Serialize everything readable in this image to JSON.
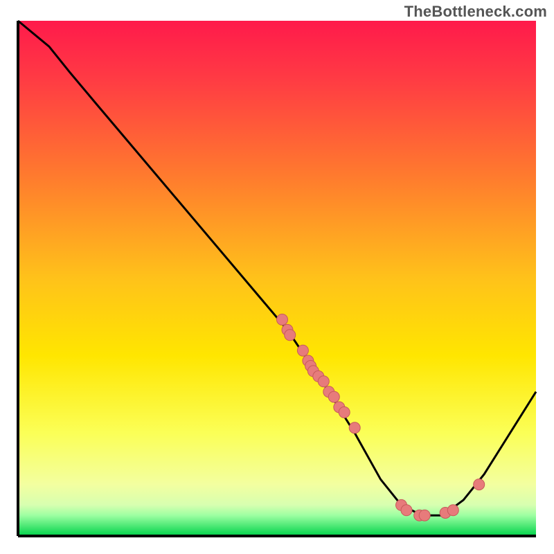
{
  "watermark": "TheBottleneck.com",
  "chart_data": {
    "type": "line",
    "title": "",
    "xlabel": "",
    "ylabel": "",
    "xlim": [
      0,
      100
    ],
    "ylim": [
      0,
      100
    ],
    "curve": [
      {
        "x": 0,
        "y": 100
      },
      {
        "x": 6,
        "y": 95
      },
      {
        "x": 10,
        "y": 90
      },
      {
        "x": 15,
        "y": 84
      },
      {
        "x": 52,
        "y": 40
      },
      {
        "x": 56,
        "y": 34
      },
      {
        "x": 60,
        "y": 28
      },
      {
        "x": 65,
        "y": 20
      },
      {
        "x": 70,
        "y": 11
      },
      {
        "x": 74,
        "y": 6
      },
      {
        "x": 78,
        "y": 4
      },
      {
        "x": 82,
        "y": 4
      },
      {
        "x": 86,
        "y": 7
      },
      {
        "x": 90,
        "y": 12
      },
      {
        "x": 95,
        "y": 20
      },
      {
        "x": 100,
        "y": 28
      }
    ],
    "series": [
      {
        "name": "markers",
        "points": [
          {
            "x": 51,
            "y": 42
          },
          {
            "x": 52,
            "y": 40
          },
          {
            "x": 52.5,
            "y": 39
          },
          {
            "x": 55,
            "y": 36
          },
          {
            "x": 56,
            "y": 34
          },
          {
            "x": 56.5,
            "y": 33
          },
          {
            "x": 57,
            "y": 32
          },
          {
            "x": 58,
            "y": 31
          },
          {
            "x": 59,
            "y": 30
          },
          {
            "x": 60,
            "y": 28
          },
          {
            "x": 61,
            "y": 27
          },
          {
            "x": 62,
            "y": 25
          },
          {
            "x": 63,
            "y": 24
          },
          {
            "x": 65,
            "y": 21
          },
          {
            "x": 74,
            "y": 6
          },
          {
            "x": 75,
            "y": 5
          },
          {
            "x": 77.5,
            "y": 4
          },
          {
            "x": 78.5,
            "y": 4
          },
          {
            "x": 82.5,
            "y": 4.5
          },
          {
            "x": 84,
            "y": 5
          },
          {
            "x": 89,
            "y": 10
          }
        ]
      }
    ],
    "colors": {
      "curve": "#000000",
      "marker_fill": "#e77b7b",
      "marker_stroke": "#c75a5a",
      "green_band_top": "#8dff7a",
      "green_band_bottom": "#00d24a",
      "grad_top": "#ff1a4b",
      "grad_mid": "#ffe600",
      "grad_low": "#f3ffa0"
    }
  }
}
